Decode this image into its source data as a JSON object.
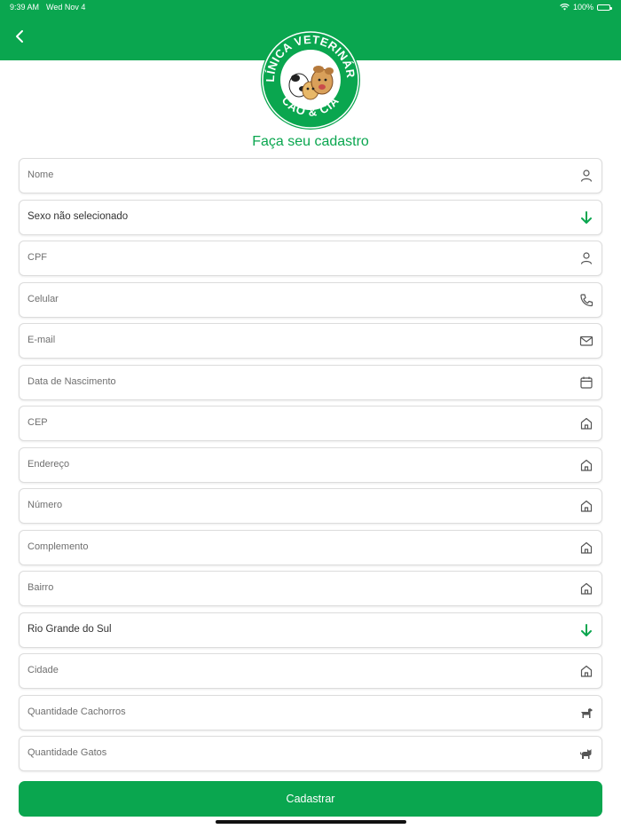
{
  "status_bar": {
    "time": "9:39 AM",
    "date": "Wed Nov 4",
    "battery": "100%"
  },
  "logo": {
    "top_text": "CLÍNICA VETERINÁRIA",
    "bottom_text": "CÃO & CIA"
  },
  "title": "Faça seu cadastro",
  "fields": [
    {
      "label": "Nome",
      "icon": "person-icon",
      "kind": "input"
    },
    {
      "label": "Sexo não selecionado",
      "icon": "arrow-down-icon",
      "kind": "select"
    },
    {
      "label": "CPF",
      "icon": "person-icon",
      "kind": "input"
    },
    {
      "label": "Celular",
      "icon": "phone-icon",
      "kind": "input"
    },
    {
      "label": "E-mail",
      "icon": "mail-icon",
      "kind": "input"
    },
    {
      "label": "Data de Nascimento",
      "icon": "calendar-icon",
      "kind": "input"
    },
    {
      "label": "CEP",
      "icon": "home-icon",
      "kind": "input"
    },
    {
      "label": "Endereço",
      "icon": "home-icon",
      "kind": "input"
    },
    {
      "label": "Número",
      "icon": "home-icon",
      "kind": "input"
    },
    {
      "label": "Complemento",
      "icon": "home-icon",
      "kind": "input"
    },
    {
      "label": "Bairro",
      "icon": "home-icon",
      "kind": "input"
    },
    {
      "label": "Rio Grande do Sul",
      "icon": "arrow-down-icon",
      "kind": "select"
    },
    {
      "label": "Cidade",
      "icon": "home-icon",
      "kind": "input"
    },
    {
      "label": "Quantidade Cachorros",
      "icon": "dog-icon",
      "kind": "input"
    },
    {
      "label": "Quantidade Gatos",
      "icon": "cat-icon",
      "kind": "input"
    }
  ],
  "submit_label": "Cadastrar",
  "colors": {
    "primary": "#0aa64f",
    "border": "#dcdcdc",
    "placeholder": "#6f6f6f"
  }
}
